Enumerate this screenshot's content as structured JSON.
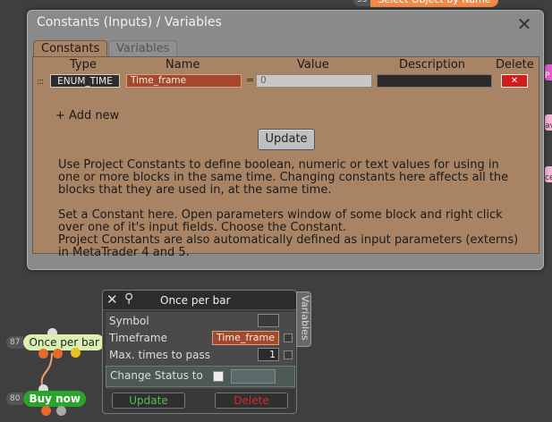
{
  "background_nodes": {
    "top_node": {
      "num": "55",
      "label": "Select Object by Name"
    },
    "once_per_bar_node": {
      "num": "87",
      "label": "Once per bar"
    },
    "buy_now_node": {
      "num": "80",
      "label": "Buy now"
    },
    "edge_chip_labels": [
      "P",
      "av",
      "ce"
    ]
  },
  "constants_dialog": {
    "title": "Constants (Inputs) / Variables",
    "tabs": [
      {
        "label": "Constants",
        "active": true
      },
      {
        "label": "Variables",
        "active": false
      }
    ],
    "columns": [
      "Type",
      "Name",
      "Value",
      "Description",
      "Delete"
    ],
    "rows": [
      {
        "type": "ENUM_TIME",
        "name": "Time_frame",
        "value": "0",
        "description": "",
        "delete_icon": "x-icon"
      }
    ],
    "add_new_label": "+ Add new",
    "update_label": "Update",
    "help_paragraphs": [
      "Use Project Constants to define boolean, numeric or text values for using in one or more blocks in the same time. Changing constants here affects all the blocks that they are used in, at the same time.",
      "Set a Constant here. Open parameters window of some block and right click over one of it's input fields. Choose the Constant.\nProject Constants are also automatically defined as input parameters (externs) in MetaTrader 4 and 5."
    ]
  },
  "node_panel": {
    "title": "Once per bar",
    "side_tab_label": "Variables",
    "fields": [
      {
        "label": "Symbol",
        "value": ""
      },
      {
        "label": "Timeframe",
        "value": "Time_frame"
      },
      {
        "label": "Max. times to pass",
        "value": "1"
      }
    ],
    "change_status_label": "Change Status to",
    "update_label": "Update",
    "delete_label": "Delete",
    "colors": {
      "update": "#4fbf4f",
      "delete": "#d02a2a",
      "constant_field": "#a5482b"
    }
  }
}
